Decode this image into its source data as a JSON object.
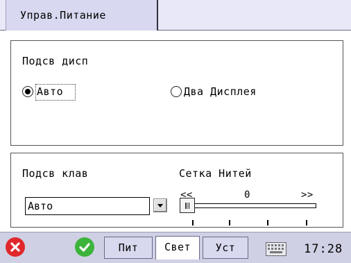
{
  "tabs": {
    "active_label": "Управ.Питание"
  },
  "display_backlight": {
    "heading": "Подсв дисп",
    "options": [
      {
        "label": "Авто",
        "selected": true
      },
      {
        "label": "Два Дисплея",
        "selected": false
      }
    ]
  },
  "keyboard_backlight": {
    "heading": "Подсв клав",
    "selected_value": "Авто"
  },
  "reticle": {
    "heading": "Сетка Нитей",
    "left_label": "<<",
    "value_label": "0",
    "right_label": ">>",
    "level": 0
  },
  "taskbar": {
    "buttons": [
      "Пит",
      "Свет",
      "Уст"
    ],
    "active_button": "Свет",
    "clock": "17:28"
  },
  "colors": {
    "close_icon": "#e0282c",
    "ok_icon": "#3cb43c",
    "tab_bar": "#e8e8f8",
    "taskbar": "#cfd0e4"
  }
}
